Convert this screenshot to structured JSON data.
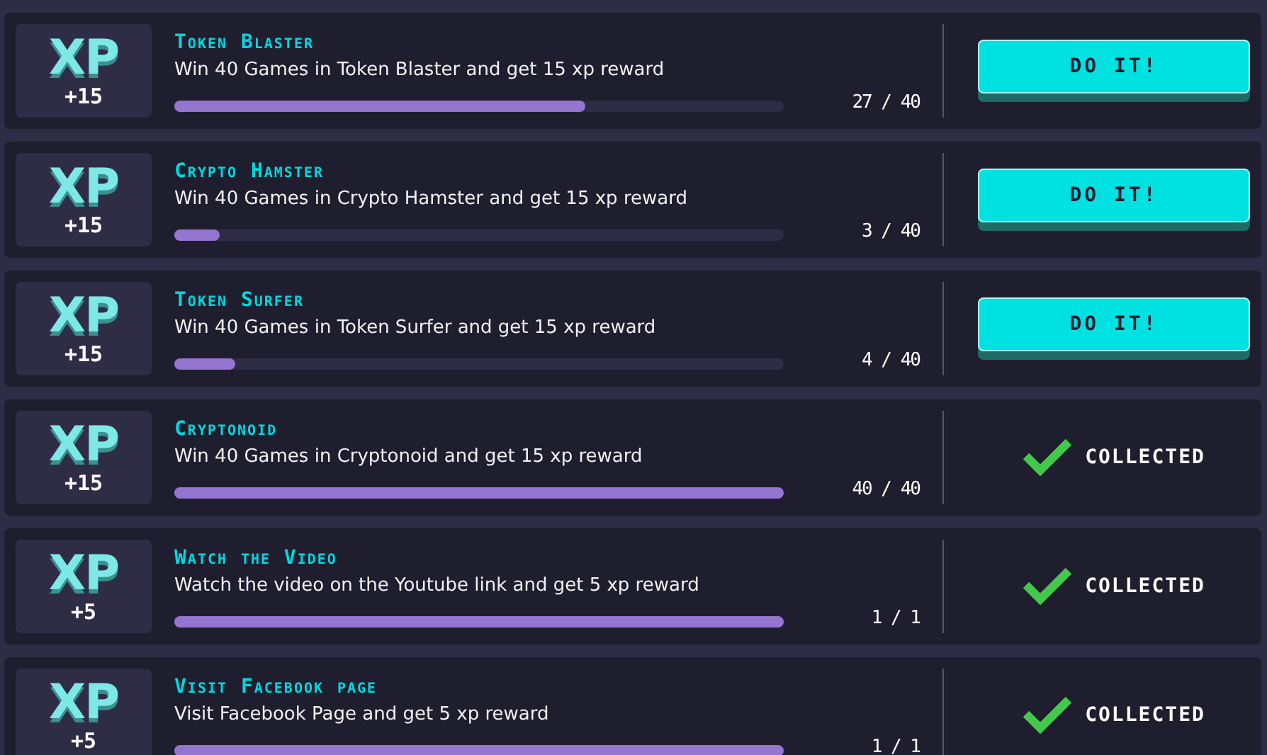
{
  "quests": [
    {
      "badge": "XP",
      "reward": "+15",
      "title": "Token Blaster",
      "description": "Win 40 Games in Token Blaster and get 15 xp reward",
      "level": 0.675,
      "count": "27 / 40",
      "action": {
        "kind": "button",
        "label": "DO IT!"
      }
    },
    {
      "badge": "XP",
      "reward": "+15",
      "title": "Crypto Hamster",
      "description": "Win 40 Games in Crypto Hamster and get 15 xp reward",
      "level": 0.075,
      "count": "3 / 40",
      "action": {
        "kind": "button",
        "label": "DO IT!"
      }
    },
    {
      "badge": "XP",
      "reward": "+15",
      "title": "Token Surfer",
      "description": "Win 40 Games in Token Surfer and get 15 xp reward",
      "level": 0.1,
      "count": "4 / 40",
      "action": {
        "kind": "button",
        "label": "DO IT!"
      }
    },
    {
      "badge": "XP",
      "reward": "+15",
      "title": "Cryptonoid",
      "description": "Win 40 Games in Cryptonoid and get 15 xp reward",
      "level": 1,
      "count": "40 / 40",
      "action": {
        "kind": "collected",
        "label": "COLLECTED"
      }
    },
    {
      "badge": "XP",
      "reward": "+5",
      "title": "Watch the Video",
      "description": "Watch the video on the Youtube link and get 5 xp reward",
      "level": 1,
      "count": "1 / 1",
      "action": {
        "kind": "collected",
        "label": "COLLECTED"
      }
    },
    {
      "badge": "XP",
      "reward": "+5",
      "title": "Visit Facebook page",
      "description": "Visit Facebook Page and get 5 xp reward",
      "level": 1,
      "count": "1 / 1",
      "action": {
        "kind": "collected",
        "label": "COLLECTED"
      }
    }
  ]
}
